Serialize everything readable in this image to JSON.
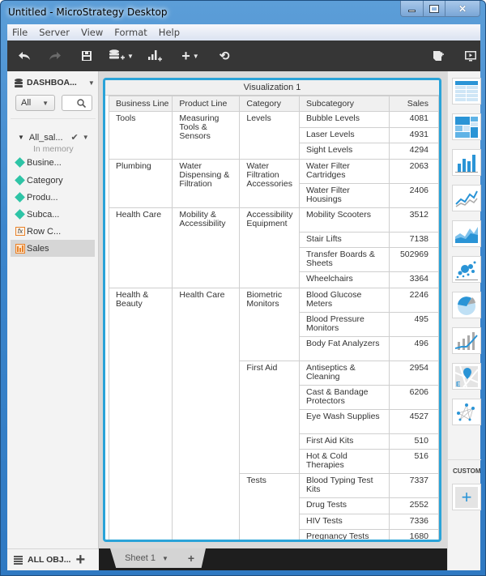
{
  "window": {
    "title": "Untitled - MicroStrategy Desktop",
    "controls": {
      "minimize": "▁",
      "maximize": "□",
      "close": "✕"
    }
  },
  "menu": [
    "File",
    "Server",
    "View",
    "Format",
    "Help"
  ],
  "toolbar": {
    "buttons": [
      {
        "name": "undo",
        "icon": "undo-arrow"
      },
      {
        "name": "redo",
        "icon": "redo-arrow",
        "disabled": true
      },
      {
        "name": "save",
        "icon": "floppy-disk"
      },
      {
        "name": "add-data",
        "icon": "database-plus",
        "dropdown": true
      },
      {
        "name": "add-visualization",
        "icon": "chart-plus"
      },
      {
        "name": "insert",
        "icon": "plus",
        "dropdown": true
      },
      {
        "name": "refresh",
        "icon": "refresh"
      },
      {
        "name": "export",
        "icon": "export-page"
      },
      {
        "name": "presentation",
        "icon": "presentation-monitor"
      }
    ]
  },
  "sidebar": {
    "header": "DASHBOA...",
    "filter": {
      "selected": "All"
    },
    "search": {
      "placeholder": ""
    },
    "dataset": {
      "name": "All_sal...",
      "status": "In memory"
    },
    "objects": [
      {
        "label": "Busine...",
        "type": "attribute"
      },
      {
        "label": "Category",
        "type": "attribute"
      },
      {
        "label": "Produ...",
        "type": "attribute"
      },
      {
        "label": "Subca...",
        "type": "attribute"
      },
      {
        "label": "Row C...",
        "type": "derived-metric"
      },
      {
        "label": "Sales",
        "type": "metric",
        "selected": true
      }
    ],
    "footer": "ALL OBJ..."
  },
  "visualization": {
    "title": "Visualization 1",
    "columns": [
      "Business Line",
      "Product Line",
      "Category",
      "Subcategory",
      "Sales"
    ],
    "rows": [
      {
        "business": "Tools",
        "product": "Measuring Tools & Sensors",
        "category": "Levels",
        "subcategory": "Bubble Levels",
        "sales": "4081"
      },
      {
        "business": "Tools",
        "product": "Measuring Tools & Sensors",
        "category": "Levels",
        "subcategory": "Laser Levels",
        "sales": "4931"
      },
      {
        "business": "Tools",
        "product": "Measuring Tools & Sensors",
        "category": "Levels",
        "subcategory": "Sight Levels",
        "sales": "4294"
      },
      {
        "business": "Plumbing",
        "product": "Water Dispensing & Filtration",
        "category": "Water Filtration Accessories",
        "subcategory": "Water Filter Cartridges",
        "sales": "2063"
      },
      {
        "business": "Plumbing",
        "product": "Water Dispensing & Filtration",
        "category": "Water Filtration Accessories",
        "subcategory": "Water Filter Housings",
        "sales": "2406"
      },
      {
        "business": "Health Care",
        "product": "Mobility & Accessibility",
        "category": "Accessibility Equipment",
        "subcategory": "Mobility Scooters",
        "sales": "3512"
      },
      {
        "business": "Health Care",
        "product": "Mobility & Accessibility",
        "category": "Accessibility Equipment",
        "subcategory": "Stair Lifts",
        "sales": "7138"
      },
      {
        "business": "Health Care",
        "product": "Mobility & Accessibility",
        "category": "Accessibility Equipment",
        "subcategory": "Transfer Boards & Sheets",
        "sales": "502969"
      },
      {
        "business": "Health Care",
        "product": "Mobility & Accessibility",
        "category": "Accessibility Equipment",
        "subcategory": "Wheelchairs",
        "sales": "3364"
      },
      {
        "business": "Health & Beauty",
        "product": "Health Care",
        "category": "Biometric Monitors",
        "subcategory": "Blood Glucose Meters",
        "sales": "2246"
      },
      {
        "business": "Health & Beauty",
        "product": "Health Care",
        "category": "Biometric Monitors",
        "subcategory": "Blood Pressure Monitors",
        "sales": "495"
      },
      {
        "business": "Health & Beauty",
        "product": "Health Care",
        "category": "Biometric Monitors",
        "subcategory": "Body Fat Analyzers",
        "sales": "496"
      },
      {
        "business": "Health & Beauty",
        "product": "Health Care",
        "category": "First Aid",
        "subcategory": "Antiseptics & Cleaning",
        "sales": "2954"
      },
      {
        "business": "Health & Beauty",
        "product": "Health Care",
        "category": "First Aid",
        "subcategory": "Cast & Bandage Protectors",
        "sales": "6206"
      },
      {
        "business": "Health & Beauty",
        "product": "Health Care",
        "category": "First Aid",
        "subcategory": "Eye Wash Supplies",
        "sales": "4527"
      },
      {
        "business": "Health & Beauty",
        "product": "Health Care",
        "category": "First Aid",
        "subcategory": "First Aid Kits",
        "sales": "510"
      },
      {
        "business": "Health & Beauty",
        "product": "Health Care",
        "category": "First Aid",
        "subcategory": "Hot & Cold Therapies",
        "sales": "516"
      },
      {
        "business": "Health & Beauty",
        "product": "Health Care",
        "category": "Tests",
        "subcategory": "Blood Typing Test Kits",
        "sales": "7337"
      },
      {
        "business": "Health & Beauty",
        "product": "Health Care",
        "category": "Tests",
        "subcategory": "Drug Tests",
        "sales": "2552"
      },
      {
        "business": "Health & Beauty",
        "product": "Health Care",
        "category": "Tests",
        "subcategory": "HIV Tests",
        "sales": "7336"
      },
      {
        "business": "Health & Beauty",
        "product": "Health Care",
        "category": "Tests",
        "subcategory": "Pregnancy Tests",
        "sales": "1680"
      }
    ]
  },
  "sheets": {
    "tabs": [
      "Sheet 1"
    ],
    "add_label": "+"
  },
  "gallery": {
    "items": [
      "grid",
      "heat-map",
      "bar-chart",
      "line-chart",
      "area-chart",
      "bubble-chart",
      "pie-chart",
      "combo-chart",
      "map",
      "network"
    ],
    "custom_label": "CUSTOM",
    "custom_add": "+"
  },
  "colors": {
    "accent": "#2aa3d8",
    "attribute": "#2ec4a6",
    "metric": "#e8822a",
    "toolbar": "#363636"
  }
}
